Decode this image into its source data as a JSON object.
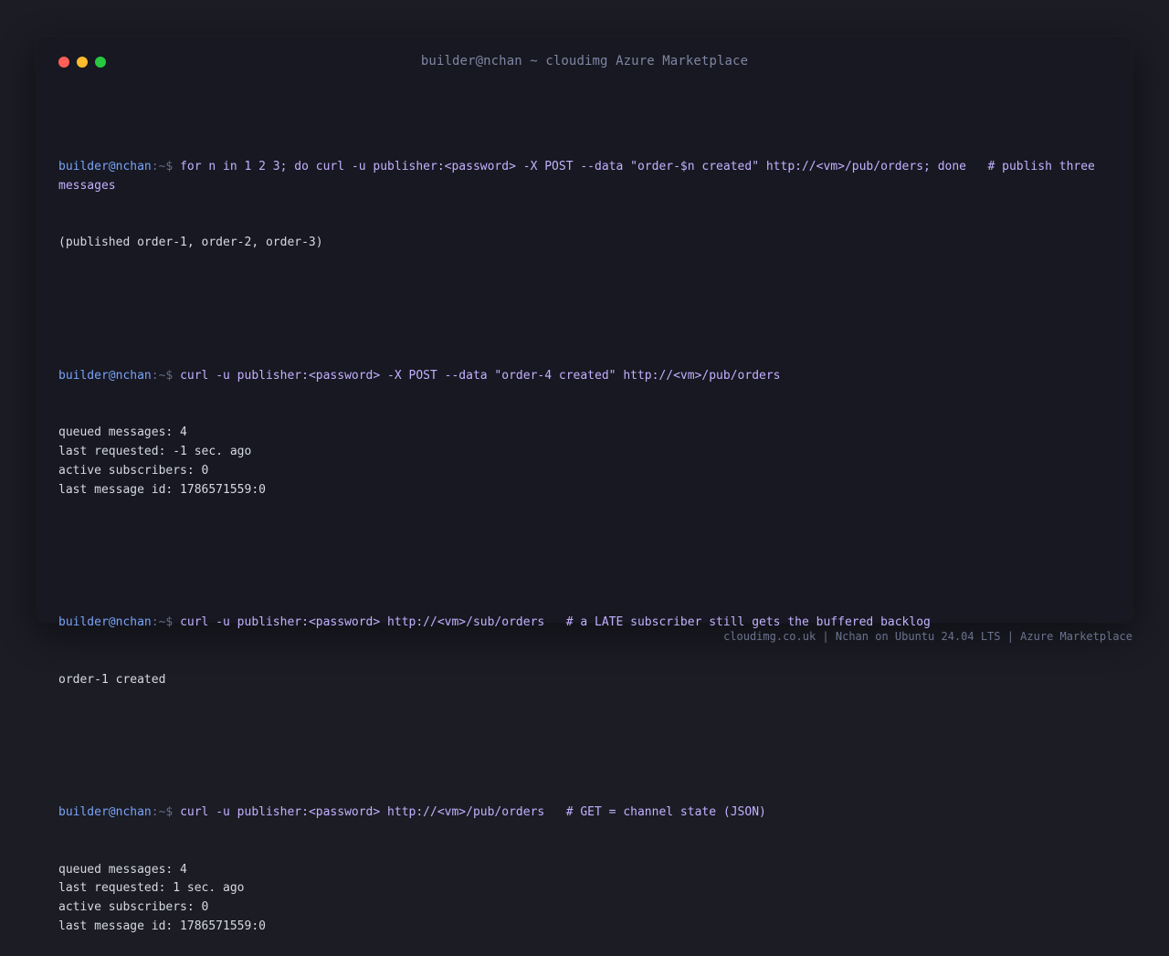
{
  "window": {
    "title": "builder@nchan ~ cloudimg Azure Marketplace"
  },
  "prompt": {
    "user": "builder@nchan",
    "path": ":~$ "
  },
  "blocks": [
    {
      "command": "for n in 1 2 3; do curl -u publisher:<password> -X POST --data \"order-$n created\" http://<vm>/pub/orders; done   # publish three messages",
      "output": [
        "(published order-1, order-2, order-3)"
      ]
    },
    {
      "command": "curl -u publisher:<password> -X POST --data \"order-4 created\" http://<vm>/pub/orders",
      "output": [
        "queued messages: 4",
        "last requested: -1 sec. ago",
        "active subscribers: 0",
        "last message id: 1786571559:0"
      ]
    },
    {
      "command": "curl -u publisher:<password> http://<vm>/sub/orders   # a LATE subscriber still gets the buffered backlog",
      "output": [
        "order-1 created"
      ]
    },
    {
      "command": "curl -u publisher:<password> http://<vm>/pub/orders   # GET = channel state (JSON)",
      "output": [
        "queued messages: 4",
        "last requested: 1 sec. ago",
        "active subscribers: 0",
        "last message id: 1786571559:0"
      ]
    }
  ],
  "footer": {
    "text": "cloudimg.co.uk | Nchan on Ubuntu 24.04 LTS | Azure Marketplace"
  },
  "colors": {
    "background": "#1b1c24",
    "window": "#171821",
    "user": "#7aa2f7",
    "command": "#c4b0ff",
    "output": "#d6d8e3"
  }
}
